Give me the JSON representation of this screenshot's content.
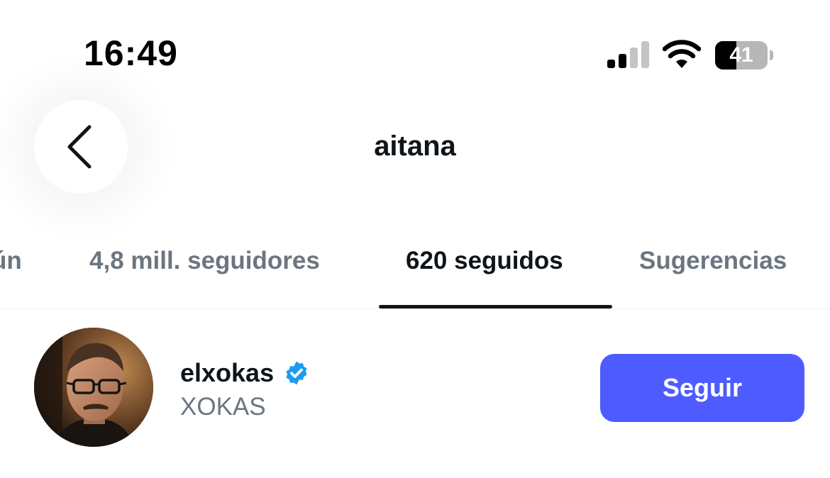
{
  "status_bar": {
    "time": "16:49",
    "battery_level": "41",
    "battery_fraction": 0.41,
    "signal_bars_active": 2,
    "signal_bars_total": 4
  },
  "header": {
    "title": "aitana"
  },
  "tabs": [
    {
      "label": "En común",
      "visible_fragment": "ún",
      "active": false
    },
    {
      "label": "4,8 mill. seguidores",
      "active": false
    },
    {
      "label": "620 seguidos",
      "active": true
    },
    {
      "label": "Sugerencias",
      "active": false
    }
  ],
  "users": [
    {
      "name": "elxokas",
      "handle": "XOKAS",
      "verified": true,
      "action_label": "Seguir"
    }
  ],
  "colors": {
    "accent": "#4d5bff",
    "verified": "#1d9bf0",
    "text_primary": "#0f1419",
    "text_secondary": "#6b7680",
    "divider": "#eff3f4"
  },
  "icons": {
    "back": "chevron-left-icon",
    "verified": "verified-badge-icon",
    "signal": "signal-bars-icon",
    "wifi": "wifi-icon",
    "battery": "battery-icon"
  }
}
